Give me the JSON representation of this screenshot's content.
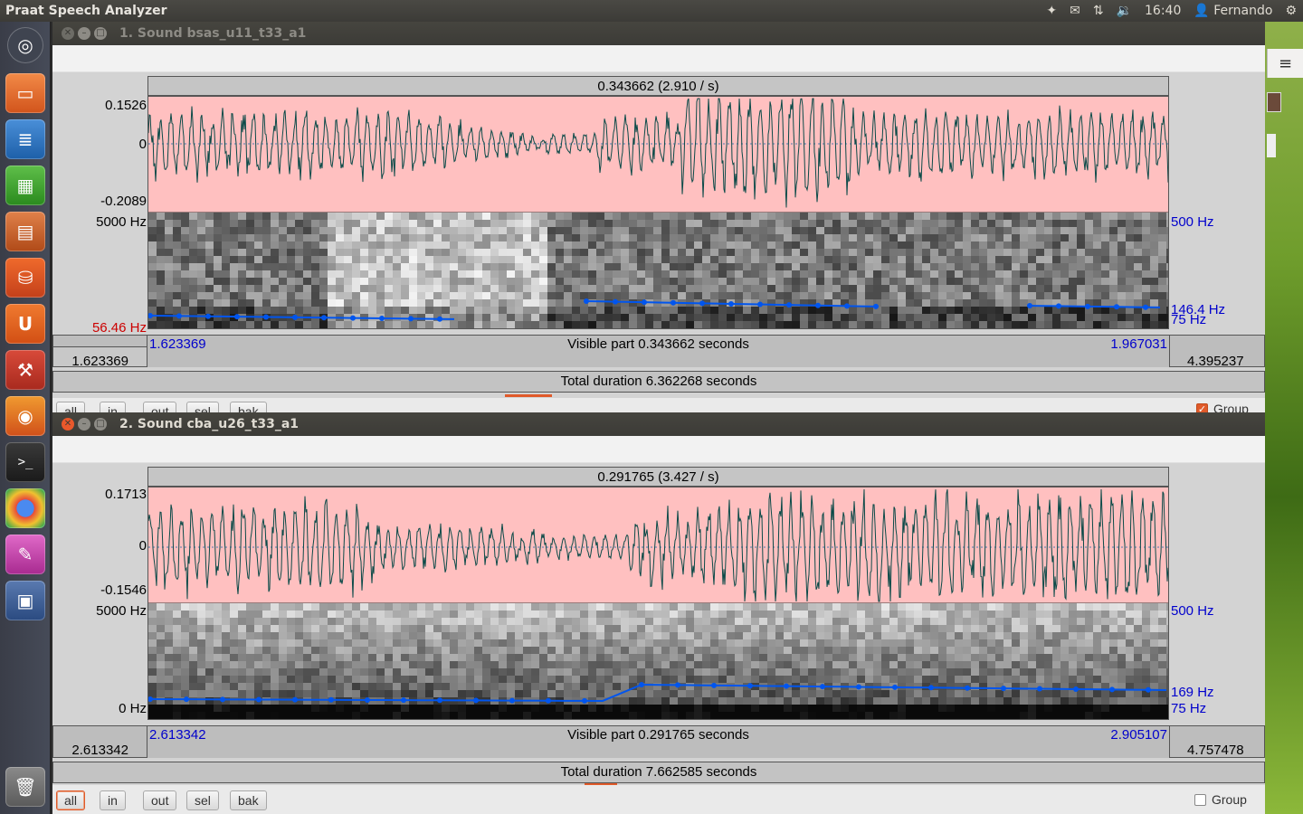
{
  "topbar": {
    "app_title": "Praat Speech Analyzer",
    "time": "16:40",
    "user": "Fernando",
    "icons": [
      "dropbox-icon",
      "mail-icon",
      "network-icon",
      "volume-icon",
      "user-icon",
      "power-gear-icon"
    ]
  },
  "launcher": {
    "items": [
      "dash-home",
      "files",
      "writer",
      "calc",
      "impress",
      "software-center",
      "ubuntu-one",
      "system-settings",
      "firefox",
      "terminal",
      "chrome",
      "app-pink",
      "workspace-switcher",
      "trash"
    ]
  },
  "windows": [
    {
      "title": "1. Sound bsas_u11_t33_a1",
      "selection_label": "0.343662 (2.910 / s)",
      "wave_max": "0.1526",
      "wave_zero": "0",
      "wave_min": "-0.2089",
      "spec_top": "5000 Hz",
      "spec_bottom": "56.46 Hz",
      "pitch_top": "500 Hz",
      "pitch_current": "146.4 Hz",
      "pitch_floor": "75 Hz",
      "vis_start": "1.623369",
      "vis_end": "1.967031",
      "visible_part": "Visible part 0.343662 seconds",
      "left_time": "1.623369",
      "right_time": "4.395237",
      "total_duration": "Total duration 6.362268 seconds",
      "buttons": [
        "all",
        "in",
        "out",
        "sel",
        "bak"
      ],
      "group_label": "Group"
    },
    {
      "title": "2. Sound cba_u26_t33_a1",
      "selection_label": "0.291765 (3.427 / s)",
      "wave_max": "0.1713",
      "wave_zero": "0",
      "wave_min": "-0.1546",
      "spec_top": "5000 Hz",
      "spec_bottom": "0 Hz",
      "pitch_top": "500 Hz",
      "pitch_current": "169 Hz",
      "pitch_floor": "75 Hz",
      "vis_start": "2.613342",
      "vis_end": "2.905107",
      "visible_part": "Visible part 0.291765 seconds",
      "left_time": "2.613342",
      "right_time": "4.757478",
      "total_duration": "Total duration 7.662585 seconds",
      "buttons": [
        "all",
        "in",
        "out",
        "sel",
        "bak"
      ],
      "group_label": "Group"
    }
  ],
  "colors": {
    "wave_bg": "#ffc0c0",
    "wave_line": "#0b4a48",
    "pitch_line": "#0055ee",
    "accent": "#e05a2a",
    "axis_blue": "#0000cc",
    "axis_red": "#cc0000"
  }
}
